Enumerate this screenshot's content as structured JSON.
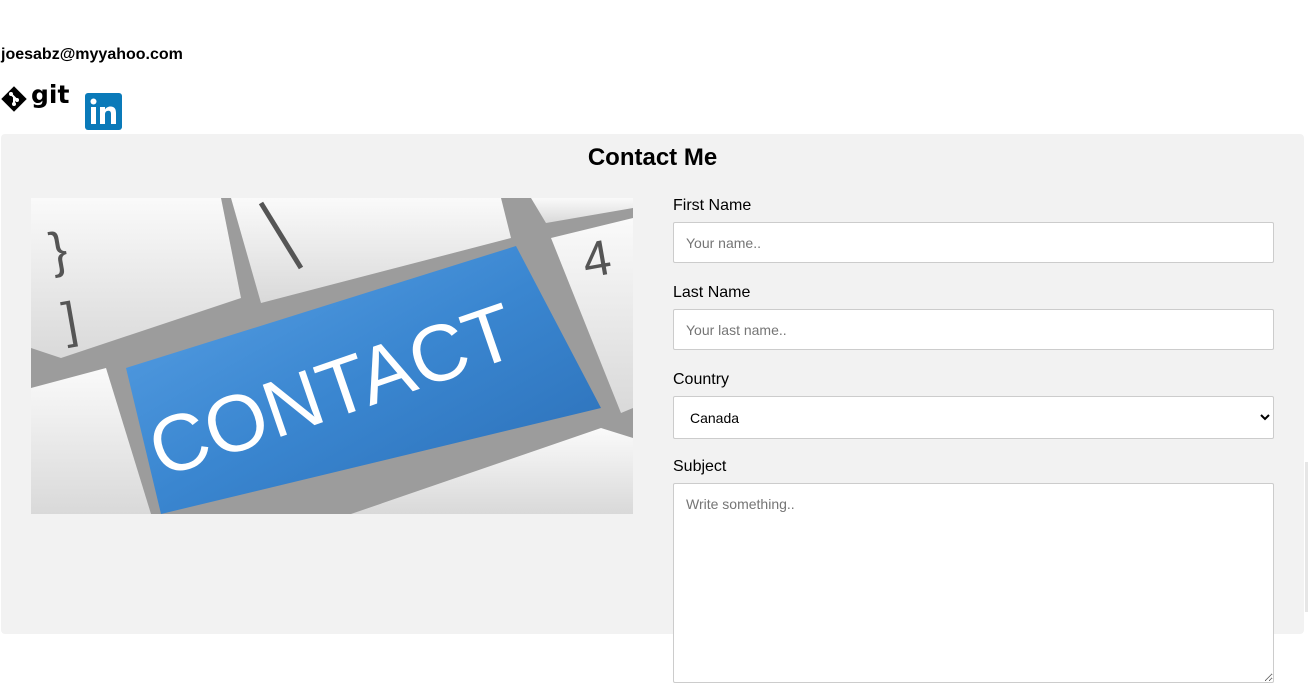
{
  "header": {
    "email": "joesabz@myyahoo.com",
    "git_label": "git",
    "linkedin_label": "in"
  },
  "contact": {
    "title": "Contact Me",
    "hero_text": "CONTACT",
    "form": {
      "first_name": {
        "label": "First Name",
        "placeholder": "Your name.."
      },
      "last_name": {
        "label": "Last Name",
        "placeholder": "Your last name.."
      },
      "country": {
        "label": "Country",
        "selected": "Canada"
      },
      "subject": {
        "label": "Subject",
        "placeholder": "Write something.."
      }
    }
  },
  "colors": {
    "section_bg": "#f2f2f2",
    "linkedin_blue": "#0a7ab9",
    "key_blue": "#3a86d0",
    "input_border": "#cccccc"
  }
}
